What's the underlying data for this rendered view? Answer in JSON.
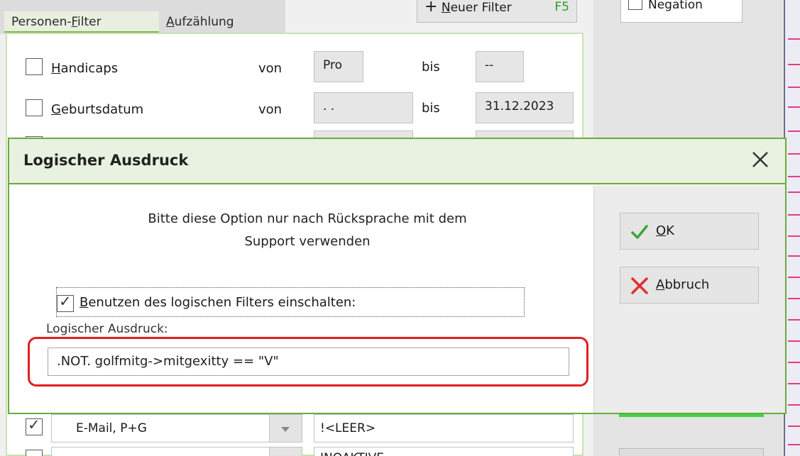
{
  "tabs": {
    "personen_pre": "Personen-",
    "personen_acc": "F",
    "personen_post": "ilter",
    "aufzaehlung_acc": "A",
    "aufzaehlung_post": "ufzählung"
  },
  "toolbar": {
    "neuer_filter_acc": "N",
    "neuer_filter_post": "euer Filter",
    "neuer_filter_shortcut": "F5",
    "negation_label": "Negation"
  },
  "filters": {
    "handicaps": {
      "acc": "H",
      "post": "andicaps",
      "von": "von",
      "from": "Pro",
      "bis": "bis",
      "to": "--"
    },
    "geburtsdatum": {
      "acc": "G",
      "post": "eburtsdatum",
      "von": "von",
      "from": " .  .",
      "bis": "bis",
      "to": "31.12.2023"
    },
    "email_row": {
      "select_value": "E-Mail, P+G",
      "value": "!<LEER>"
    },
    "bottom_row": {
      "value": "INOAKTIVE"
    }
  },
  "dialog": {
    "title": "Logischer Ausdruck",
    "info_line1": "Bitte diese Option nur nach Rücksprache mit dem",
    "info_line2": "Support verwenden",
    "use_filter_acc": "B",
    "use_filter_post": "enutzen des logischen Filters einschalten:",
    "expr_label": "Logischer Ausdruck:",
    "expr_value": ".NOT. golfmitg->mitgexitty == \"V\"",
    "ok_acc": "O",
    "ok_post": "K",
    "cancel_acc": "A",
    "cancel_post": "bbruch"
  },
  "colors": {
    "accent_green": "#6aab3b",
    "highlight_red": "#e02020",
    "ok_check": "#3aa63a",
    "cancel_x": "#e03030"
  },
  "icons": [
    "close-icon",
    "checkmark-icon",
    "x-icon",
    "chevron-down-icon",
    "checkbox-checked-icon"
  ]
}
